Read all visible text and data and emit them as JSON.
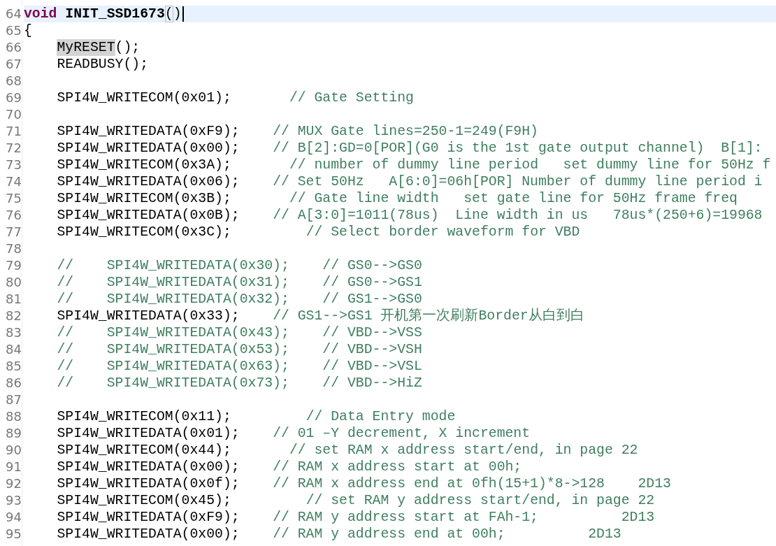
{
  "editor": {
    "lines": [
      {
        "number": "64",
        "current": true,
        "segments": [
          {
            "kind": "keyword",
            "text": "void"
          },
          {
            "kind": "function",
            "text": " INIT_SSD1673"
          },
          {
            "kind": "bracket_match",
            "text": "("
          },
          {
            "kind": "code",
            "text": ")"
          }
        ]
      },
      {
        "number": "65",
        "current": false,
        "segments": [
          {
            "kind": "code",
            "text": "{"
          }
        ]
      },
      {
        "number": "66",
        "current": false,
        "segments": [
          {
            "kind": "occurrence",
            "text": "    MyRESET"
          },
          {
            "kind": "code",
            "text": "();"
          }
        ]
      },
      {
        "number": "67",
        "current": false,
        "segments": [
          {
            "kind": "code",
            "text": "    READBUSY();"
          }
        ]
      },
      {
        "number": "68",
        "current": false
      },
      {
        "number": "69",
        "current": false,
        "segments": [
          {
            "kind": "code",
            "text": "    SPI4W_WRITECOM(0x01);"
          },
          {
            "kind": "comment",
            "text": "       // Gate Setting"
          }
        ]
      },
      {
        "number": "70",
        "current": false
      },
      {
        "number": "71",
        "current": false,
        "segments": [
          {
            "kind": "code",
            "text": "    SPI4W_WRITEDATA(0xF9);"
          },
          {
            "kind": "comment",
            "text": "    // MUX Gate lines=250-1=249(F9H)"
          }
        ]
      },
      {
        "number": "72",
        "current": false,
        "segments": [
          {
            "kind": "code",
            "text": "    SPI4W_WRITEDATA(0x00);"
          },
          {
            "kind": "comment",
            "text": "    // B[2]:GD=0[POR](G0 is the 1st gate output channel)  B[1]:"
          }
        ]
      },
      {
        "number": "73",
        "current": false,
        "segments": [
          {
            "kind": "code",
            "text": "    SPI4W_WRITECOM(0x3A);"
          },
          {
            "kind": "comment",
            "text": "       // number of dummy line period   set dummy line for 50Hz f"
          }
        ]
      },
      {
        "number": "74",
        "current": false,
        "segments": [
          {
            "kind": "code",
            "text": "    SPI4W_WRITEDATA(0x06);"
          },
          {
            "kind": "comment",
            "text": "    // Set 50Hz   A[6:0]=06h[POR] Number of dummy line period i"
          }
        ]
      },
      {
        "number": "75",
        "current": false,
        "segments": [
          {
            "kind": "code",
            "text": "    SPI4W_WRITECOM(0x3B);"
          },
          {
            "kind": "comment",
            "text": "       // Gate line width   set gate line for 50Hz frame freq"
          }
        ]
      },
      {
        "number": "76",
        "current": false,
        "segments": [
          {
            "kind": "code",
            "text": "    SPI4W_WRITEDATA(0x0B);"
          },
          {
            "kind": "comment",
            "text": "    // A[3:0]=1011(78us)  Line width in us   78us*(250+6)=19968"
          }
        ]
      },
      {
        "number": "77",
        "current": false,
        "segments": [
          {
            "kind": "code",
            "text": "    SPI4W_WRITECOM(0x3C);"
          },
          {
            "kind": "comment",
            "text": "         // Select border waveform for VBD"
          }
        ]
      },
      {
        "number": "78",
        "current": false
      },
      {
        "number": "79",
        "current": false,
        "segments": [
          {
            "kind": "comment",
            "text": "    //    SPI4W_WRITEDATA(0x30);    // GS0-->GS0"
          }
        ]
      },
      {
        "number": "80",
        "current": false,
        "segments": [
          {
            "kind": "comment",
            "text": "    //    SPI4W_WRITEDATA(0x31);    // GS0-->GS1"
          }
        ]
      },
      {
        "number": "81",
        "current": false,
        "segments": [
          {
            "kind": "comment",
            "text": "    //    SPI4W_WRITEDATA(0x32);    // GS1-->GS0"
          }
        ]
      },
      {
        "number": "82",
        "current": false,
        "segments": [
          {
            "kind": "code",
            "text": "    SPI4W_WRITEDATA(0x33);"
          },
          {
            "kind": "comment",
            "text": "    // GS1-->GS1 开机第一次刷新Border从白到白"
          }
        ]
      },
      {
        "number": "83",
        "current": false,
        "segments": [
          {
            "kind": "comment",
            "text": "    //    SPI4W_WRITEDATA(0x43);    // VBD-->VSS"
          }
        ]
      },
      {
        "number": "84",
        "current": false,
        "segments": [
          {
            "kind": "comment",
            "text": "    //    SPI4W_WRITEDATA(0x53);    // VBD-->VSH"
          }
        ]
      },
      {
        "number": "85",
        "current": false,
        "segments": [
          {
            "kind": "comment",
            "text": "    //    SPI4W_WRITEDATA(0x63);    // VBD-->VSL"
          }
        ]
      },
      {
        "number": "86",
        "current": false,
        "segments": [
          {
            "kind": "comment",
            "text": "    //    SPI4W_WRITEDATA(0x73);    // VBD-->HiZ"
          }
        ]
      },
      {
        "number": "87",
        "current": false
      },
      {
        "number": "88",
        "current": false,
        "segments": [
          {
            "kind": "code",
            "text": "    SPI4W_WRITECOM(0x11);"
          },
          {
            "kind": "comment",
            "text": "         // Data Entry mode"
          }
        ]
      },
      {
        "number": "89",
        "current": false,
        "segments": [
          {
            "kind": "code",
            "text": "    SPI4W_WRITEDATA(0x01);"
          },
          {
            "kind": "comment",
            "text": "    // 01 –Y decrement, X increment"
          }
        ]
      },
      {
        "number": "90",
        "current": false,
        "segments": [
          {
            "kind": "code",
            "text": "    SPI4W_WRITECOM(0x44);"
          },
          {
            "kind": "comment",
            "text": "       // set RAM x address start/end, in page 22"
          }
        ]
      },
      {
        "number": "91",
        "current": false,
        "segments": [
          {
            "kind": "code",
            "text": "    SPI4W_WRITEDATA(0x00);"
          },
          {
            "kind": "comment",
            "text": "    // RAM x address start at 00h;"
          }
        ]
      },
      {
        "number": "92",
        "current": false,
        "segments": [
          {
            "kind": "code",
            "text": "    SPI4W_WRITEDATA(0x0f);"
          },
          {
            "kind": "comment",
            "text": "    // RAM x address end at 0fh(15+1)*8->128    2D13"
          }
        ]
      },
      {
        "number": "93",
        "current": false,
        "segments": [
          {
            "kind": "code",
            "text": "    SPI4W_WRITECOM(0x45);"
          },
          {
            "kind": "comment",
            "text": "         // set RAM y address start/end, in page 22"
          }
        ]
      },
      {
        "number": "94",
        "current": false,
        "segments": [
          {
            "kind": "code",
            "text": "    SPI4W_WRITEDATA(0xF9);"
          },
          {
            "kind": "comment",
            "text": "    // RAM y address start at FAh-1;          2D13"
          }
        ]
      },
      {
        "number": "95",
        "current": false,
        "segments": [
          {
            "kind": "code",
            "text": "    SPI4W_WRITEDATA(0x00);"
          },
          {
            "kind": "comment",
            "text": "    // RAM y address end at 00h;          2D13"
          }
        ]
      }
    ]
  }
}
